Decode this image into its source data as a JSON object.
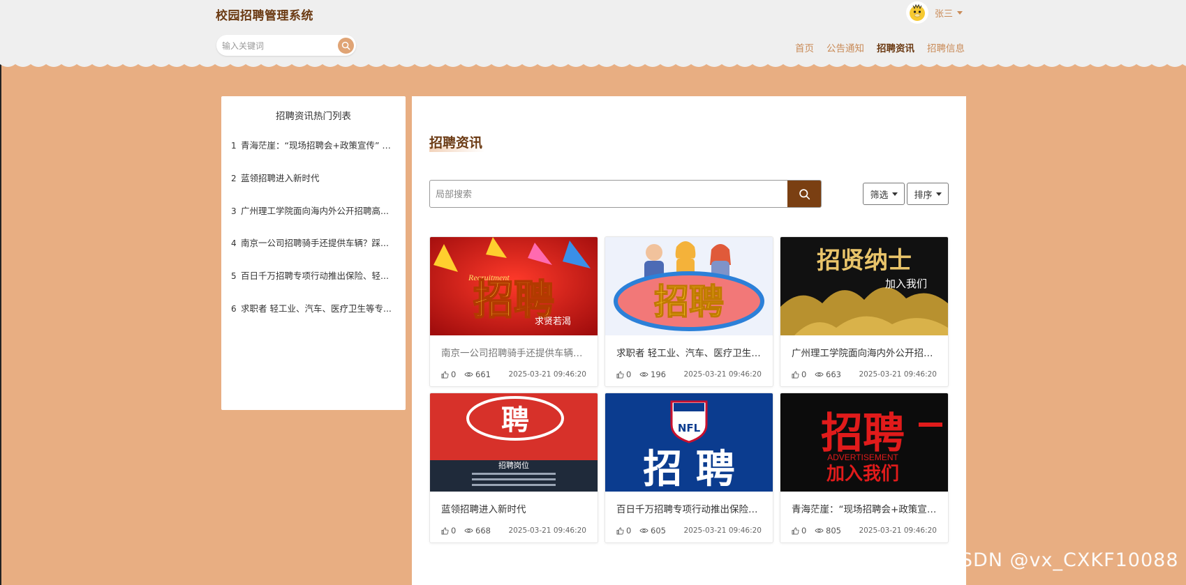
{
  "header": {
    "site_title": "校园招聘管理系统",
    "search_placeholder": "输入关键词",
    "user_name": "张三",
    "nav": [
      "首页",
      "公告通知",
      "招聘资讯",
      "招聘信息"
    ],
    "active_nav": "招聘资讯"
  },
  "sidebar": {
    "title": "招聘资讯热门列表",
    "items": [
      {
        "num": "1",
        "text": "青海茫崖：“现场招聘会+政策宣传” 实..."
      },
      {
        "num": "2",
        "text": "蓝领招聘进入新时代"
      },
      {
        "num": "3",
        "text": "广州理工学院面向海内外公开招聘高..."
      },
      {
        "num": "4",
        "text": "南京一公司招聘骑手还提供车辆？踩..."
      },
      {
        "num": "5",
        "text": "百日千万招聘专项行动推出保险、轻..."
      },
      {
        "num": "6",
        "text": "求职者 轻工业、汽车、医疗卫生等专..."
      }
    ]
  },
  "main": {
    "title": "招聘资讯",
    "search_placeholder": "局部搜索",
    "filter_label": "筛选",
    "sort_label": "排序",
    "cards": [
      {
        "title": "南京一公司招聘骑手还提供车辆？...",
        "likes": "0",
        "views": "661",
        "date": "2025-03-21 09:46:20",
        "img_text": "招聘",
        "img_sub": "求贤若渴",
        "img_en": "Recruitment"
      },
      {
        "title": "求职者 轻工业、汽车、医疗卫生等...",
        "likes": "0",
        "views": "196",
        "date": "2025-03-21 09:46:20",
        "img_text": "招聘"
      },
      {
        "title": "广州理工学院面向海内外公开招聘...",
        "likes": "0",
        "views": "663",
        "date": "2025-03-21 09:46:20",
        "img_text": "招贤纳士",
        "img_sub": "加入我们"
      },
      {
        "title": "蓝领招聘进入新时代",
        "likes": "0",
        "views": "668",
        "date": "2025-03-21 09:46:20",
        "img_text": "聘",
        "img_sub": "招聘岗位"
      },
      {
        "title": "百日千万招聘专项行动推出保险、...",
        "likes": "0",
        "views": "605",
        "date": "2025-03-21 09:46:20",
        "img_text": "招 聘",
        "img_en": "NFL"
      },
      {
        "title": "青海茫崖：“现场招聘会+政策宣传”...",
        "likes": "0",
        "views": "805",
        "date": "2025-03-21 09:46:20",
        "img_text": "招聘",
        "img_sub": "加入我们",
        "img_en": "ADVERTISEMENT"
      }
    ]
  },
  "watermark": "CSDN @vx_CXKF10088",
  "colors": {
    "accent": "#e8ae82",
    "brand_dark": "#6b3a13",
    "nav": "#c98b58",
    "search_btn": "#7a3f12"
  }
}
